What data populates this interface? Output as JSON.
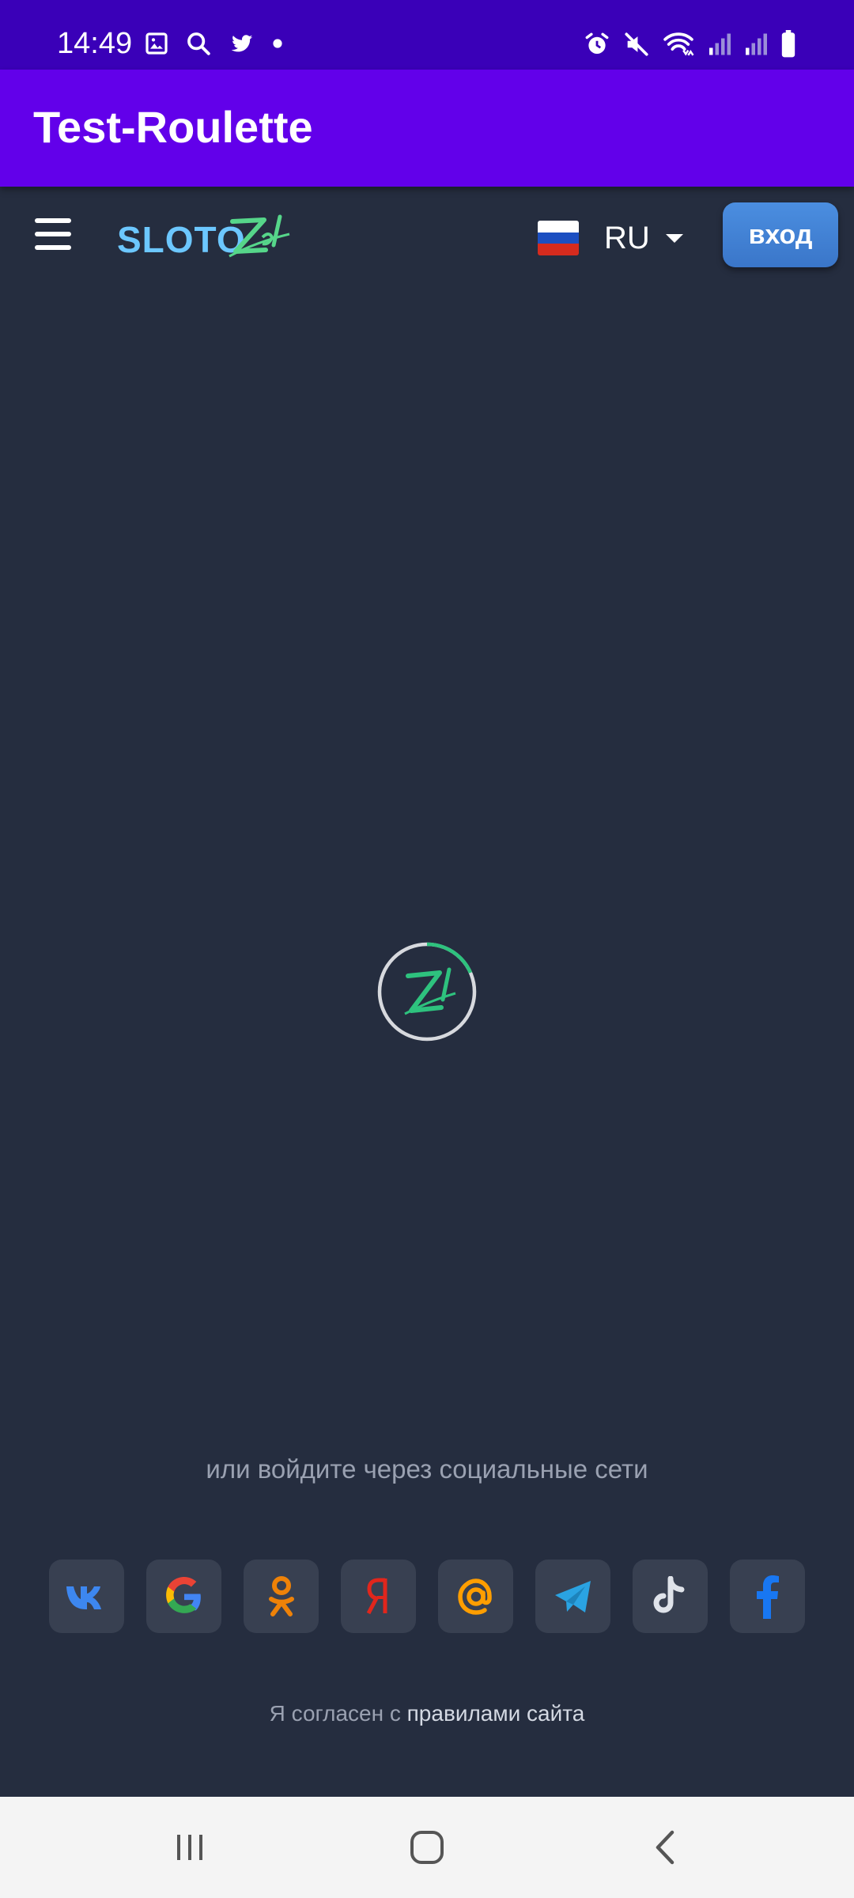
{
  "status_bar": {
    "time": "14:49",
    "left_icons": [
      "gallery-icon",
      "search-icon",
      "twitter-icon",
      "dot-icon"
    ],
    "right_icons": [
      "alarm-icon",
      "mute-icon",
      "wifi-icon",
      "signal-icon",
      "signal-icon",
      "battery-icon"
    ]
  },
  "app_bar": {
    "title": "Test-Roulette"
  },
  "header": {
    "logo_text": "SLOTO",
    "logo_script": "Zal",
    "language": "RU",
    "login_label": "вход"
  },
  "loader": {
    "icon": "zal-logo-spinner-icon"
  },
  "social": {
    "caption": "или войдите через социальные сети",
    "providers": [
      "VK",
      "Google",
      "Odnoklassniki",
      "Yandex",
      "Mail.ru",
      "Telegram",
      "TikTok",
      "Facebook"
    ]
  },
  "agreement": {
    "prefix": "Я согласен с ",
    "link": "правилами сайта"
  },
  "colors": {
    "status_bar": "#3a00b8",
    "app_bar": "#6200ea",
    "page_bg": "#252d3f",
    "login_button": "#4b8ee0",
    "accent_green": "#2ec27e"
  },
  "nav_bar": {
    "icons": [
      "recent-apps-icon",
      "home-icon",
      "back-icon"
    ]
  }
}
